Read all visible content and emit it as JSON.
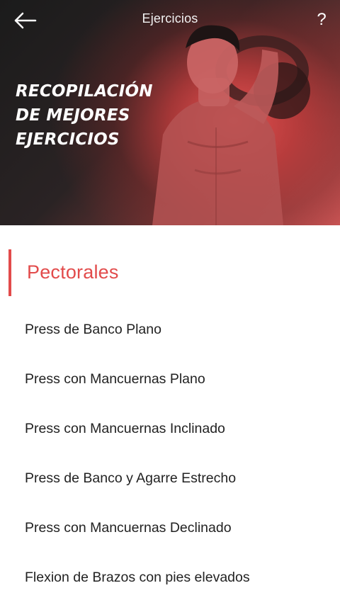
{
  "topbar": {
    "title": "Ejercicios",
    "back_icon": "arrow-left-icon",
    "help_label": "?"
  },
  "hero": {
    "heading_lines": [
      "RECOPILACIÓN",
      "DE MEJORES",
      "EJERCICIOS"
    ],
    "accent_color": "#e24b4b"
  },
  "section": {
    "title": "Pectorales"
  },
  "exercises": [
    "Press de Banco Plano",
    "Press con Mancuernas Plano",
    "Press con Mancuernas Inclinado",
    "Press de Banco y Agarre Estrecho",
    "Press con Mancuernas Declinado",
    "Flexion de Brazos con pies elevados"
  ]
}
